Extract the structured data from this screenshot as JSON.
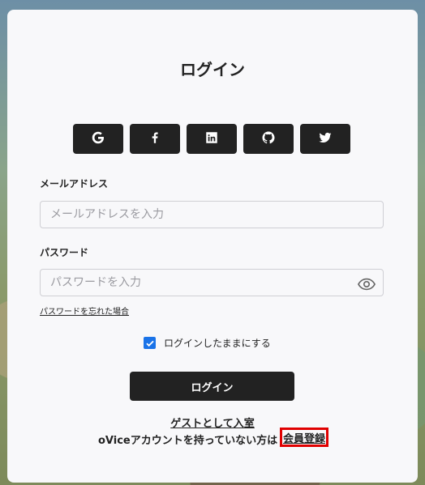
{
  "login": {
    "title": "ログイン",
    "social_buttons": [
      {
        "icon": "google-icon"
      },
      {
        "icon": "facebook-icon"
      },
      {
        "icon": "linkedin-icon"
      },
      {
        "icon": "github-icon"
      },
      {
        "icon": "twitter-icon"
      }
    ],
    "email": {
      "label": "メールアドレス",
      "placeholder": "メールアドレスを入力",
      "value": ""
    },
    "password": {
      "label": "パスワード",
      "placeholder": "パスワードを入力",
      "value": ""
    },
    "forgot_password": "パスワードを忘れた場合",
    "remember": {
      "label": "ログインしたままにする",
      "checked": true
    },
    "submit_label": "ログイン",
    "guest_link": "ゲストとして入室",
    "no_account_text": "oViceアカウントを持っていない方は",
    "signup_link": "会員登録",
    "colors": {
      "button_bg": "#222222",
      "checkbox": "#1a73e8",
      "highlight": "#e00000",
      "card_bg": "#f8f8fa"
    }
  }
}
